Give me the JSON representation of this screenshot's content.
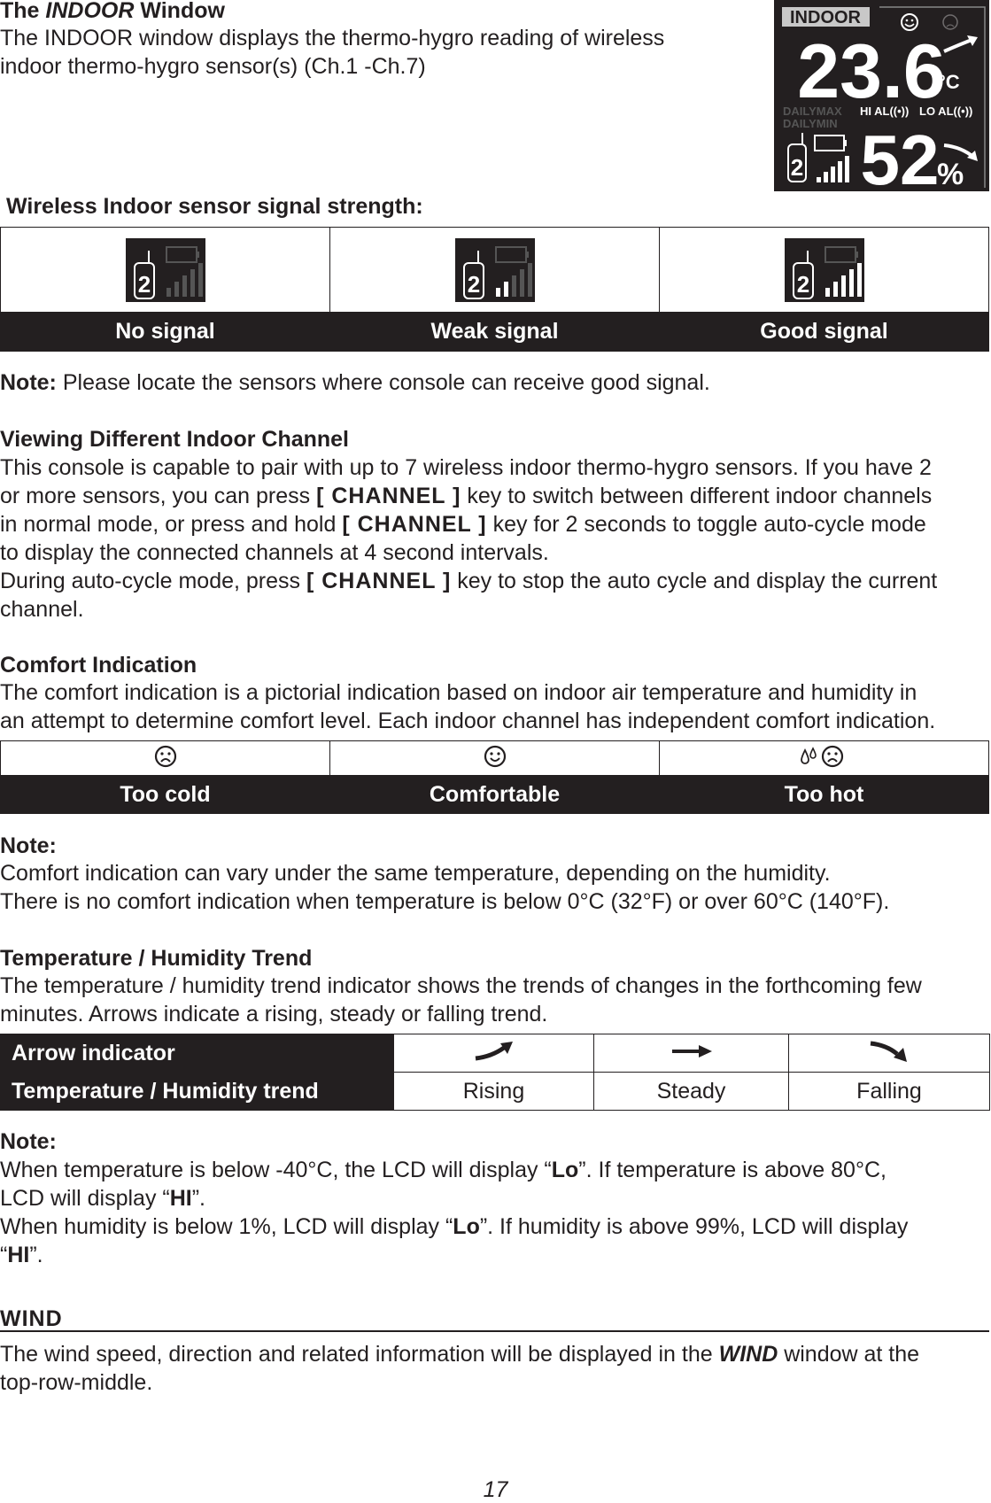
{
  "indoor": {
    "title_pre": "The ",
    "title_em": "INDOOR",
    "title_post": " Window",
    "lines": [
      "The INDOOR window displays the thermo-hygro reading of wireless",
      "indoor thermo-hygro sensor(s) (Ch.1 -Ch.7)"
    ]
  },
  "lcd": {
    "label": "INDOOR",
    "temperature": "23.6",
    "temp_unit": "°C",
    "humidity": "52",
    "humidity_unit": "%",
    "daily_max": "DAILYMAX",
    "daily_min": "DAILYMIN",
    "hi_al": "HI AL((•))",
    "lo_al": "LO AL((•))",
    "channel": "2",
    "signal_level": 5,
    "comfort": "comfortable",
    "temp_trend": "rising",
    "humidity_trend": "falling"
  },
  "signal": {
    "heading": "Wireless Indoor sensor signal strength:",
    "cells": [
      {
        "label": "No signal",
        "bars_active": 0,
        "bars_total": 5
      },
      {
        "label": "Weak signal",
        "bars_active": 2,
        "bars_total": 5
      },
      {
        "label": "Good signal",
        "bars_active": 5,
        "bars_total": 5
      }
    ],
    "note_label": "Note:",
    "note_text": " Please locate the sensors where console can receive good signal."
  },
  "channel": {
    "heading": "Viewing Different Indoor Channel",
    "lines": [
      [
        [
          "This console is capable to pair with up to 7 wireless indoor thermo-hygro sensors. If you have 2",
          ""
        ]
      ],
      [
        [
          "or more sensors, you can press ",
          ""
        ],
        [
          "[ CHANNEL ]",
          "mono"
        ],
        [
          " key to switch between different indoor channels",
          ""
        ]
      ],
      [
        [
          "in normal mode, or press and hold ",
          ""
        ],
        [
          "[ CHANNEL ]",
          "mono"
        ],
        [
          " key for 2 seconds to toggle auto-cycle mode",
          ""
        ]
      ],
      [
        [
          "to display the connected channels at 4 second intervals.",
          ""
        ]
      ],
      [
        [
          "During auto-cycle mode, press ",
          ""
        ],
        [
          "[ CHANNEL ]",
          "mono"
        ],
        [
          " key to stop the auto cycle and display the current",
          ""
        ]
      ],
      [
        [
          "channel.",
          ""
        ]
      ]
    ]
  },
  "comfort": {
    "heading": "Comfort Indication",
    "lines": [
      [
        [
          "The comfort indication is a pictorial indication based on indoor air temperature and humidity in",
          ""
        ]
      ],
      [
        [
          "an attempt to determine comfort level. Each indoor channel has independent comfort indication.",
          ""
        ]
      ]
    ],
    "cells": [
      {
        "label": "Too cold",
        "icon": "sad-face-icon"
      },
      {
        "label": "Comfortable",
        "icon": "smiley-face-icon"
      },
      {
        "label": "Too hot",
        "icon": "sweat-sad-face-icon"
      }
    ],
    "note_label": "Note:",
    "note_lines": [
      [
        [
          "Comfort indication can vary under the same temperature, depending on the humidity.",
          ""
        ]
      ],
      [
        [
          "There is no comfort indication when temperature is below 0°C (32°F) or over 60°C (140°F).",
          ""
        ]
      ]
    ]
  },
  "trend": {
    "heading": "Temperature / Humidity Trend",
    "lines": [
      [
        [
          "The temperature / humidity trend indicator shows the trends of changes in the forthcoming few",
          ""
        ]
      ],
      [
        [
          "minutes. Arrows indicate a rising, steady or falling trend.",
          ""
        ]
      ]
    ],
    "row1_label": "Arrow indicator",
    "row2_label": "Temperature / Humidity trend",
    "cells": [
      {
        "label": "Rising",
        "icon": "arrow-rising-icon"
      },
      {
        "label": "Steady",
        "icon": "arrow-steady-icon"
      },
      {
        "label": "Falling",
        "icon": "arrow-falling-icon"
      }
    ],
    "note_label": "Note:",
    "note_lines": [
      [
        [
          "When temperature is below -40°C, the LCD will display “",
          ""
        ],
        [
          "Lo",
          "b"
        ],
        [
          "”. If temperature is above 80°C,",
          ""
        ]
      ],
      [
        [
          "LCD will display “",
          ""
        ],
        [
          "HI",
          "b"
        ],
        [
          "”.",
          ""
        ]
      ],
      [
        [
          "When humidity is below 1%, LCD will display “",
          ""
        ],
        [
          "Lo",
          "b"
        ],
        [
          "”. If humidity is above 99%, LCD will display",
          ""
        ]
      ],
      [
        [
          "“",
          ""
        ],
        [
          "HI",
          "b"
        ],
        [
          "”.",
          ""
        ]
      ]
    ]
  },
  "wind": {
    "heading": "WIND",
    "lines": [
      [
        [
          "The wind speed, direction and related information will be displayed in the ",
          ""
        ],
        [
          "WIND",
          "bi"
        ],
        [
          " window at the",
          ""
        ]
      ],
      [
        [
          "top-row-middle.",
          ""
        ]
      ]
    ]
  },
  "page_number": "17"
}
